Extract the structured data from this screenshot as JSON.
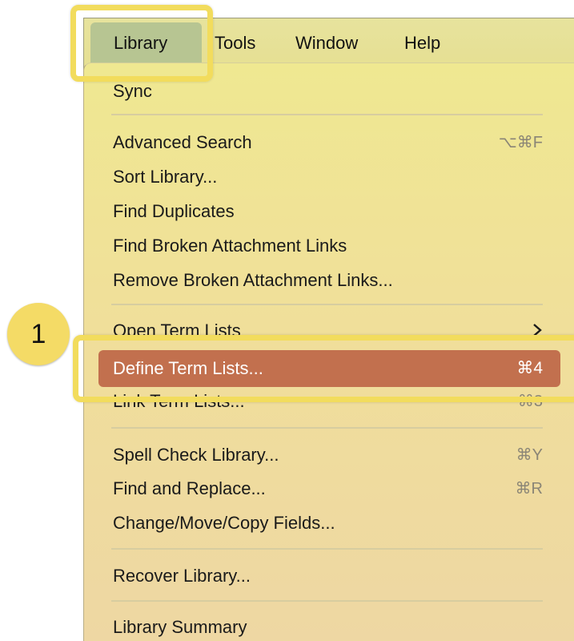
{
  "menubar": {
    "items": [
      {
        "label": "Library",
        "active": true
      },
      {
        "label": "Tools"
      },
      {
        "label": "Window"
      },
      {
        "label": "Help"
      }
    ]
  },
  "menu": {
    "items": [
      {
        "label": "Sync",
        "shortcut": ""
      },
      {
        "label": "Advanced Search",
        "shortcut": "⌥⌘F"
      },
      {
        "label": "Sort Library...",
        "shortcut": ""
      },
      {
        "label": "Find Duplicates",
        "shortcut": ""
      },
      {
        "label": "Find Broken Attachment Links",
        "shortcut": ""
      },
      {
        "label": "Remove Broken Attachment Links...",
        "shortcut": ""
      },
      {
        "label": "Open Term Lists",
        "shortcut": "",
        "submenu": true
      },
      {
        "label": "Define Term Lists...",
        "shortcut": "⌘4",
        "highlighted": true
      },
      {
        "label": "Link Term Lists...",
        "shortcut": "⌘3"
      },
      {
        "label": "Spell Check Library...",
        "shortcut": "⌘Y"
      },
      {
        "label": "Find and Replace...",
        "shortcut": "⌘R"
      },
      {
        "label": "Change/Move/Copy Fields...",
        "shortcut": ""
      },
      {
        "label": "Recover Library...",
        "shortcut": ""
      },
      {
        "label": "Library Summary",
        "shortcut": ""
      }
    ]
  },
  "callout": {
    "number": "1"
  },
  "colors": {
    "menu_bg": "#efe891",
    "highlight": "#c2704e",
    "callout_border": "#f2dc5d",
    "active_menu": "#b7c592"
  }
}
